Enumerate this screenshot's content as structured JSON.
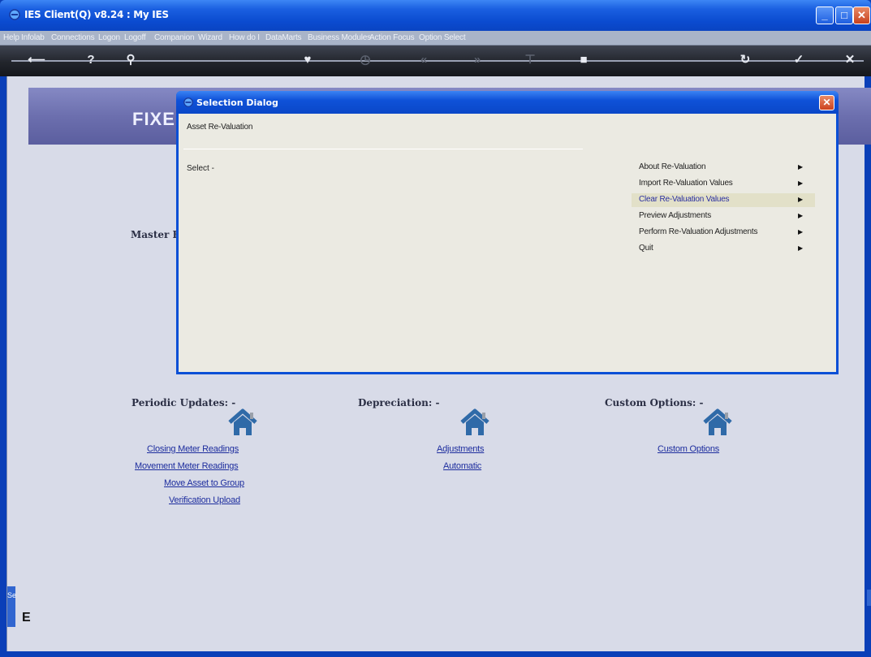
{
  "window": {
    "title": "IES Client(Q) v8.24 : My IES",
    "controls": {
      "minimize": "_",
      "maximize": "□",
      "close": "✕"
    }
  },
  "menubar": {
    "items": [
      "Help",
      "Infolab",
      "Connections",
      "Logon",
      "Logoff",
      "Companion",
      "Wizard",
      "How do I",
      "DataMarts",
      "Business Modules",
      "Action Focus",
      "Option Select"
    ]
  },
  "toolbar": {
    "icons": [
      "back-icon",
      "help-icon",
      "search-icon",
      "heart-icon",
      "clock-icon",
      "rewind-icon",
      "forward-icon",
      "pin-icon",
      "stop-icon",
      "refresh-icon",
      "check-icon",
      "close-icon"
    ]
  },
  "banner": {
    "title": "FIXE"
  },
  "master": {
    "label": "Master F"
  },
  "dialog": {
    "title": "Selection Dialog",
    "close": "✕",
    "subtitle": "Asset Re-Valuation",
    "select_label": "Select -",
    "menu": [
      {
        "label": "About Re-Valuation",
        "active": false
      },
      {
        "label": "Import Re-Valuation Values",
        "active": false
      },
      {
        "label": "Clear Re-Valuation Values",
        "active": true
      },
      {
        "label": "Preview Adjustments",
        "active": false
      },
      {
        "label": "Perform Re-Valuation Adjustments",
        "active": false
      },
      {
        "label": "Quit",
        "active": false
      }
    ],
    "arrow": "▶"
  },
  "sections": {
    "periodic": {
      "heading": "Periodic Updates: -",
      "links": [
        "Closing Meter Readings",
        "Movement Meter Readings",
        "Move Asset to Group",
        "Verification Upload"
      ]
    },
    "depreciation": {
      "heading": "Depreciation: -",
      "links": [
        "Adjustments",
        "Automatic"
      ]
    },
    "custom": {
      "heading": "Custom Options: -",
      "links": [
        "Custom Options"
      ]
    }
  },
  "side": {
    "panel_text": "Se",
    "icon_text": "E"
  },
  "colors": {
    "titlebar": "#0a4fd6",
    "workspace": "#d8dbe8",
    "link": "#1d2d9e",
    "banner": "#6c6fae"
  }
}
